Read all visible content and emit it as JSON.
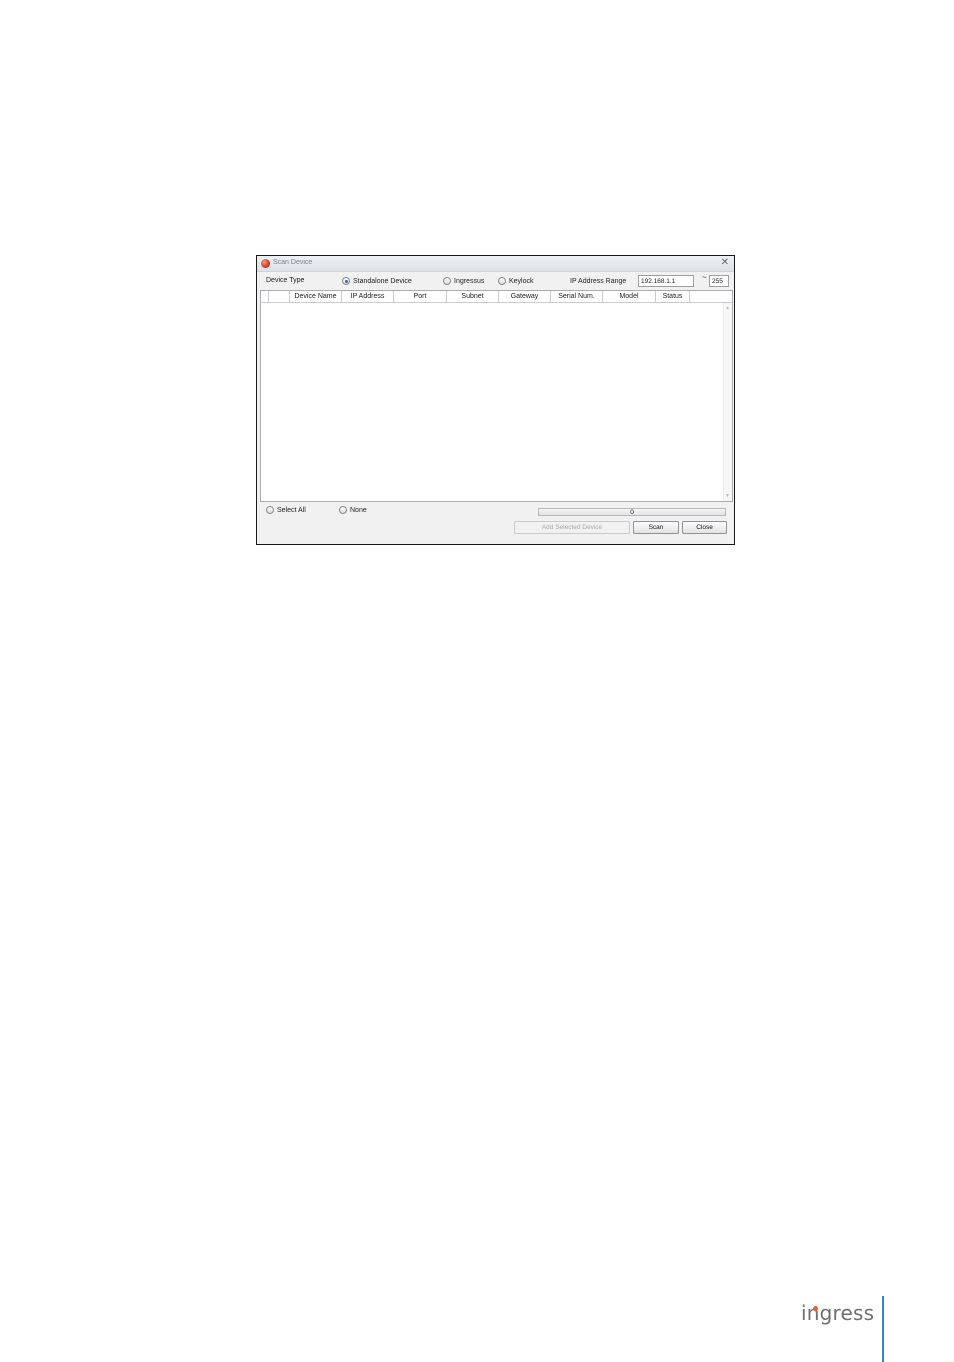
{
  "dialog": {
    "title": "Scan Device",
    "close_glyph": "✕",
    "device_type_label": "Device Type",
    "device_types": [
      {
        "label": "Standalone Device",
        "checked": true
      },
      {
        "label": "Ingressus",
        "checked": false
      },
      {
        "label": "Keylock",
        "checked": false
      }
    ],
    "ip_range_label": "IP Address Range",
    "ip_start": "192.168.1.1",
    "ip_separator": "~",
    "ip_end": "255",
    "columns": [
      "",
      "Device Name",
      "IP Address",
      "Port",
      "Subnet",
      "Gateway",
      "Serial Num.",
      "Model",
      "Status"
    ],
    "rows": [],
    "select_all_label": "Select All",
    "none_label": "None",
    "progress_value": "0",
    "progress_fraction": 0,
    "add_button": "Add Selected Device",
    "scan_button": "Scan",
    "close_button": "Close"
  },
  "brand": {
    "logo_text": "ingress",
    "accent_color": "#3b82c4",
    "dot_color": "#e8622f"
  }
}
